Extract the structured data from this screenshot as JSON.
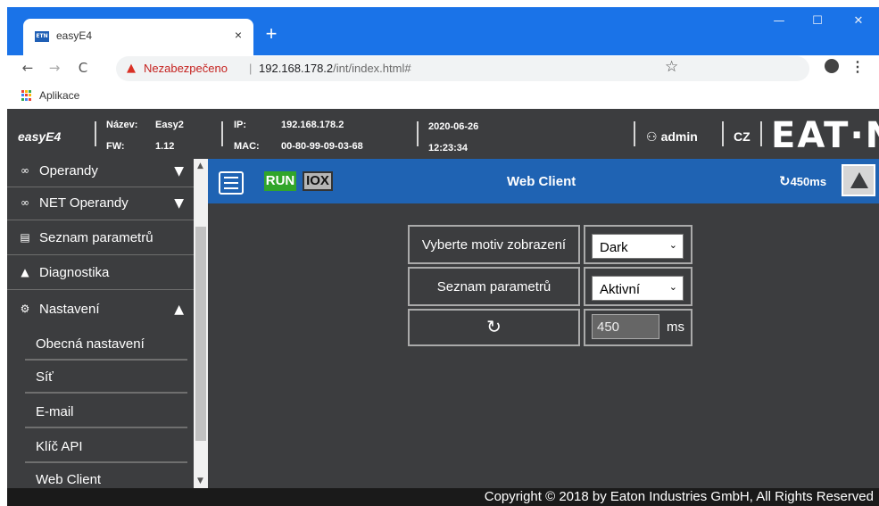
{
  "browser": {
    "tab_title": "easyE4",
    "favicon_text": "ETN",
    "tab_close": "×",
    "new_tab": "+",
    "insecure_label": "Nezabezpečeno",
    "url_separator": "|",
    "url_host": "192.168.178.2",
    "url_path": "/int/index.html#",
    "bookmarks_label": "Aplikace",
    "window_controls": {
      "minimize": "—",
      "maximize": "☐",
      "close": "✕"
    },
    "nav": {
      "back": "←",
      "forward": "→",
      "reload": "C"
    }
  },
  "header": {
    "app_name": "easyE4",
    "name_label": "Název:",
    "name_value": "Easy2",
    "fw_label": "FW:",
    "fw_value": "1.12",
    "ip_label": "IP:",
    "ip_value": "192.168.178.2",
    "mac_label": "MAC:",
    "mac_value": "00-80-99-09-03-68",
    "date": "2020-06-26",
    "time": "12:23:34",
    "user": "admin",
    "language": "CZ",
    "logo_text": "EAT·N"
  },
  "sidebar": {
    "items": [
      {
        "label": "Operandy",
        "icon": "glasses-icon",
        "glyph": "∞",
        "arrow": "▼"
      },
      {
        "label": "NET Operandy",
        "icon": "glasses-icon",
        "glyph": "∞",
        "arrow": "▼"
      },
      {
        "label": "Seznam parametrů",
        "icon": "list-icon",
        "glyph": "▤"
      },
      {
        "label": "Diagnostika",
        "icon": "warning-icon",
        "glyph": "▲"
      },
      {
        "label": "Nastavení",
        "icon": "gear-icon",
        "glyph": "⚙",
        "arrow": "▲"
      }
    ],
    "sub_items": [
      "Obecná nastavení",
      "Síť",
      "E-mail",
      "Klíč API",
      "Web Client"
    ]
  },
  "topbar": {
    "run_label": "RUN",
    "iox_label": "IOX",
    "title": "Web Client",
    "refresh_label": "450ms"
  },
  "settings": {
    "theme_label": "Vyberte motiv zobrazení",
    "theme_value": "Dark",
    "param_label": "Seznam parametrů",
    "param_value": "Aktivní",
    "refresh_value": "450",
    "refresh_unit": "ms"
  },
  "footer": {
    "copyright": "Copyright © 2018 by Eaton Industries GmbH, All Rights Reserved"
  },
  "colors": {
    "chrome_blue": "#1a73e8",
    "app_dark": "#3c3d3f",
    "topbar_blue": "#1f63b3",
    "run_green": "#31a52a"
  }
}
